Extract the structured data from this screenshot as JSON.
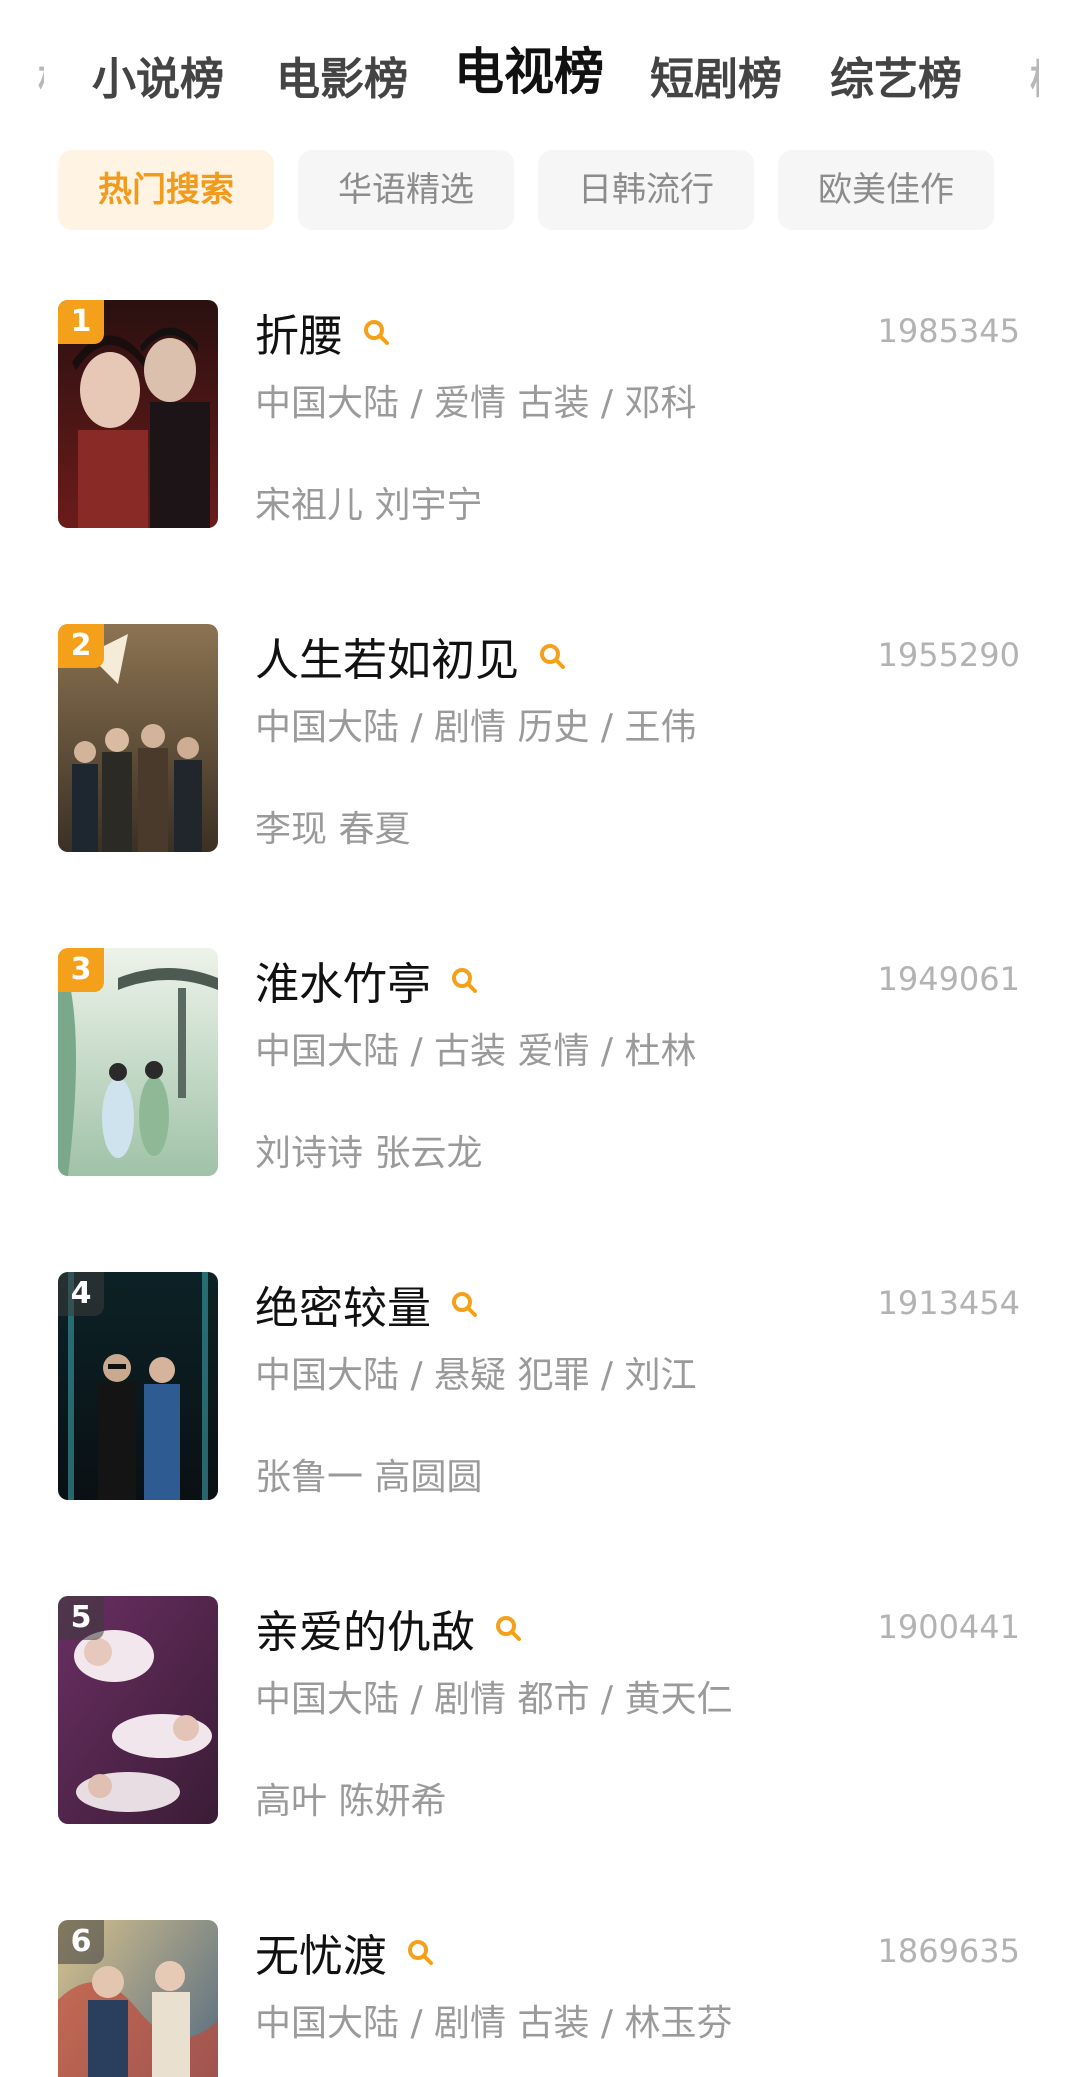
{
  "category_tabs": {
    "left_partial": "榜",
    "right_partial": "榜",
    "items": [
      {
        "label": "小说榜",
        "active": false
      },
      {
        "label": "电影榜",
        "active": false
      },
      {
        "label": "电视榜",
        "active": true
      },
      {
        "label": "短剧榜",
        "active": false
      },
      {
        "label": "综艺榜",
        "active": false
      }
    ]
  },
  "filter_chips": [
    {
      "label": "热门搜索",
      "active": true
    },
    {
      "label": "华语精选",
      "active": false
    },
    {
      "label": "日韩流行",
      "active": false
    },
    {
      "label": "欧美佳作",
      "active": false
    }
  ],
  "colors": {
    "accent": "#f5a01a",
    "chip_active_bg": "#fff4e4",
    "chip_bg": "#f6f6f6",
    "secondary_text": "#9a9a9a"
  },
  "search_icon": "search-icon",
  "ranking": [
    {
      "rank": "1",
      "title": "折腰",
      "score": "1985345",
      "meta": "中国大陆 / 爱情 古装 / 邓科",
      "cast": "宋祖儿 刘宇宁",
      "poster_colors": [
        "#3a1414",
        "#8a2a26",
        "#d9b4a2"
      ]
    },
    {
      "rank": "2",
      "title": "人生若如初见",
      "score": "1955290",
      "meta": "中国大陆 / 剧情 历史 / 王伟",
      "cast": "李现 春夏",
      "poster_colors": [
        "#7b6444",
        "#3b3226",
        "#c9b28a"
      ]
    },
    {
      "rank": "3",
      "title": "淮水竹亭",
      "score": "1949061",
      "meta": "中国大陆 / 古装 爱情 / 杜林",
      "cast": "刘诗诗 张云龙",
      "poster_colors": [
        "#c9dfc8",
        "#6e9a7e",
        "#e8efe2"
      ]
    },
    {
      "rank": "4",
      "title": "绝密较量",
      "score": "1913454",
      "meta": "中国大陆 / 悬疑 犯罪 / 刘江",
      "cast": "张鲁一 高圆圆",
      "poster_colors": [
        "#0f2a30",
        "#2f6b70",
        "#101418"
      ]
    },
    {
      "rank": "5",
      "title": "亲爱的仇敌",
      "score": "1900441",
      "meta": "中国大陆 / 剧情 都市 / 黄天仁",
      "cast": "高叶 陈妍希",
      "poster_colors": [
        "#5a2b55",
        "#c07ab0",
        "#f2e6ee"
      ]
    },
    {
      "rank": "6",
      "title": "无忧渡",
      "score": "1869635",
      "meta": "中国大陆 / 剧情 古装 / 林玉芬",
      "cast": "",
      "poster_colors": [
        "#2b4a6e",
        "#d9a24a",
        "#c24a3a"
      ]
    }
  ]
}
